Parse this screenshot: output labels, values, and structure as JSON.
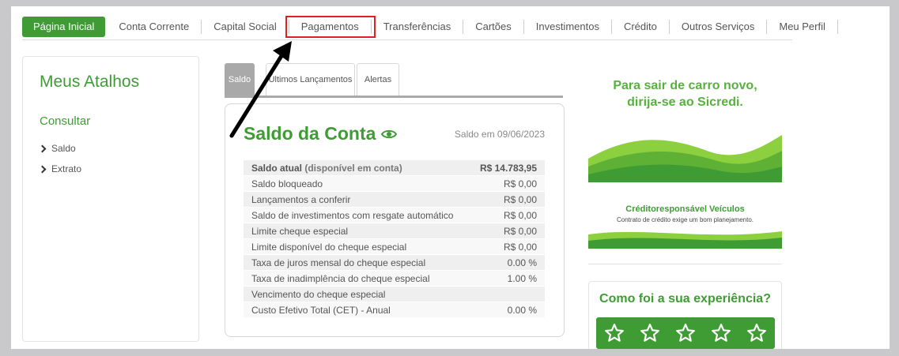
{
  "nav": {
    "items": [
      {
        "label": "Página Inicial",
        "active": true
      },
      {
        "label": "Conta Corrente"
      },
      {
        "label": "Capital Social"
      },
      {
        "label": "Pagamentos",
        "highlighted": true
      },
      {
        "label": "Transferências"
      },
      {
        "label": "Cartões"
      },
      {
        "label": "Investimentos"
      },
      {
        "label": "Crédito"
      },
      {
        "label": "Outros Serviços"
      },
      {
        "label": "Meu Perfil"
      }
    ]
  },
  "sidebar": {
    "title": "Meus Atalhos",
    "section": "Consultar",
    "links": [
      "Saldo",
      "Extrato"
    ]
  },
  "tabs": [
    "Saldo",
    "Últimos Lançamentos",
    "Alertas"
  ],
  "card": {
    "title": "Saldo da Conta",
    "date": "Saldo em 09/06/2023",
    "rows": [
      {
        "label": "Saldo atual",
        "sub": "(disponível em conta)",
        "value": "R$ 14.783,95"
      },
      {
        "label": "Saldo bloqueado",
        "value": "R$ 0,00"
      },
      {
        "label": "Lançamentos a conferir",
        "value": "R$ 0,00"
      },
      {
        "label": "Saldo de investimentos com resgate automático",
        "value": "R$ 0,00"
      },
      {
        "label": "Limite cheque especial",
        "value": "R$ 0,00"
      },
      {
        "label": "Limite disponível do cheque especial",
        "value": "R$ 0,00"
      },
      {
        "label": "Taxa de juros mensal do cheque especial",
        "value": "0.00 %"
      },
      {
        "label": "Taxa de inadimplência do cheque especial",
        "value": "1.00 %"
      },
      {
        "label": "Vencimento do cheque especial",
        "value": ""
      },
      {
        "label": "Custo Efetivo Total (CET) - Anual",
        "value": "0.00 %"
      }
    ]
  },
  "ads": {
    "car_line1": "Para sair de carro novo,",
    "car_line2": "dirija-se ao Sicredi.",
    "credit_brand": "Créditoresponsável Veículos",
    "credit_sub": "Contrato de crédito exige um bom planejamento."
  },
  "feedback": {
    "question": "Como foi a sua experiência?",
    "stars": 5
  },
  "colors": {
    "brand_green": "#3f9c35",
    "highlight_red": "#e02020"
  }
}
